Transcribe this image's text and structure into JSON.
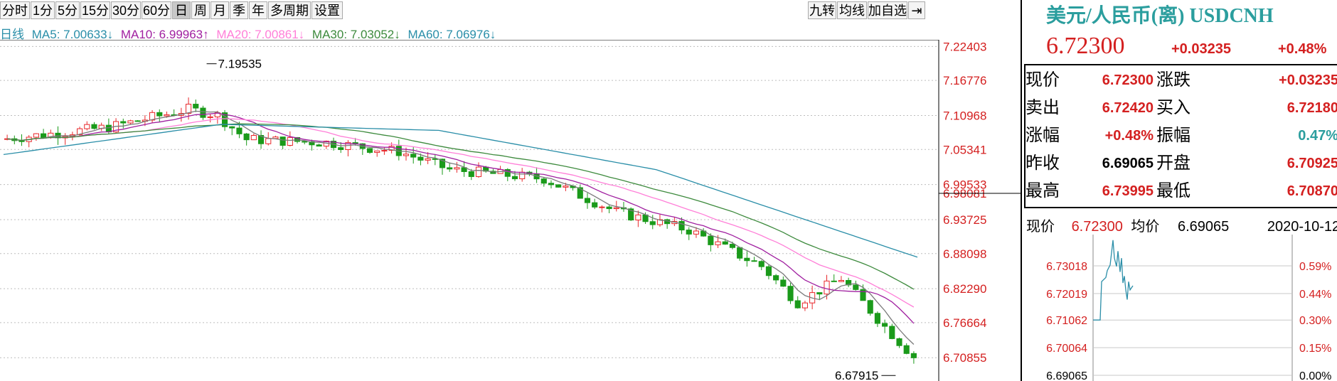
{
  "toolbar": {
    "periods": [
      "分时",
      "1分",
      "5分",
      "15分",
      "30分",
      "60分",
      "日",
      "周",
      "月",
      "季",
      "年",
      "多周期",
      "设置"
    ],
    "active": "日",
    "right_buttons": [
      "九转",
      "均线",
      "加自选"
    ]
  },
  "ma_line": {
    "label": "日线",
    "ma5": "MA5: 7.00633↓",
    "ma10": "MA10: 6.99963↑",
    "ma20": "MA20: 7.00861↓",
    "ma30": "MA30: 7.03052↓",
    "ma60": "MA60: 7.06976↓"
  },
  "colors": {
    "up": "#e8282b",
    "down": "#1a9a1a",
    "ma5": "#7a7a7a",
    "ma10": "#a020a0",
    "ma20": "#ff7fd8",
    "ma30": "#3d8a3d",
    "ma60": "#2a8ea8"
  },
  "quote": {
    "title": "美元/人民币(离) USDCNH",
    "price": "6.72300",
    "change": "+0.03235",
    "change_pct": "+0.48%",
    "rows": [
      {
        "l1": "现价",
        "v1": "6.72300",
        "l2": "涨跌",
        "v2": "+0.03235"
      },
      {
        "l1": "卖出",
        "v1": "6.72420",
        "l2": "买入",
        "v2": "6.72180"
      },
      {
        "l1": "涨幅",
        "v1": "+0.48%",
        "l2": "振幅",
        "v2": "0.47%"
      },
      {
        "l1": "昨收",
        "v1": "6.69065",
        "l2": "开盘",
        "v2": "6.70925"
      },
      {
        "l1": "最高",
        "v1": "6.73995",
        "l2": "最低",
        "v2": "6.70870"
      }
    ],
    "mini_header": {
      "label_price": "现价",
      "price": "6.72300",
      "label_avg": "均价",
      "avg": "6.69065",
      "date": "2020-10-12"
    }
  },
  "chart_data": [
    {
      "type": "candlestick",
      "y_ticks": [
        "7.22403",
        "7.16776",
        "7.10968",
        "7.05341",
        "6.99533",
        "6.98081",
        "6.93725",
        "6.88098",
        "6.82290",
        "6.76664",
        "6.70855"
      ],
      "ylim": [
        6.67,
        7.235
      ],
      "current_marker": "6.98081",
      "annotations": {
        "high": "7.19535",
        "low": "6.67915"
      },
      "ma60_end": 6.875
    },
    {
      "type": "line",
      "y_ticks_left": [
        "6.73018",
        "6.72019",
        "6.71062",
        "6.70064",
        "6.69065"
      ],
      "y_ticks_right": [
        "0.59%",
        "0.44%",
        "0.30%",
        "0.15%",
        "0.00%"
      ],
      "ylim": [
        6.69065,
        6.73995
      ]
    }
  ]
}
